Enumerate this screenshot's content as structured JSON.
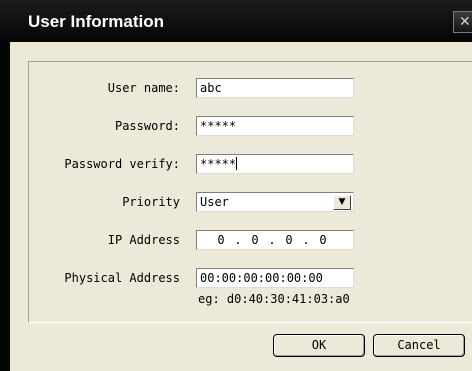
{
  "window": {
    "title": "User Information",
    "close_glyph": "✕"
  },
  "form": {
    "username": {
      "label": "User name:",
      "value": "abc"
    },
    "password": {
      "label": "Password:",
      "value": "*****"
    },
    "password_verify": {
      "label": "Password verify:",
      "value": "*****"
    },
    "priority": {
      "label": "Priority",
      "value": "User",
      "dropdown_glyph": "▼"
    },
    "ip_address": {
      "label": "IP Address",
      "octets": [
        "0",
        "0",
        "0",
        "0"
      ],
      "separator": "."
    },
    "physical_address": {
      "label": "Physical Address",
      "value": "00:00:00:00:00:00",
      "hint": "eg: d0:40:30:41:03:a0"
    }
  },
  "buttons": {
    "ok": "OK",
    "cancel": "Cancel"
  },
  "colors": {
    "titlebar": "#0a0a0a",
    "dialog_bg": "#ece9d8",
    "title_text": "#ffffff"
  }
}
